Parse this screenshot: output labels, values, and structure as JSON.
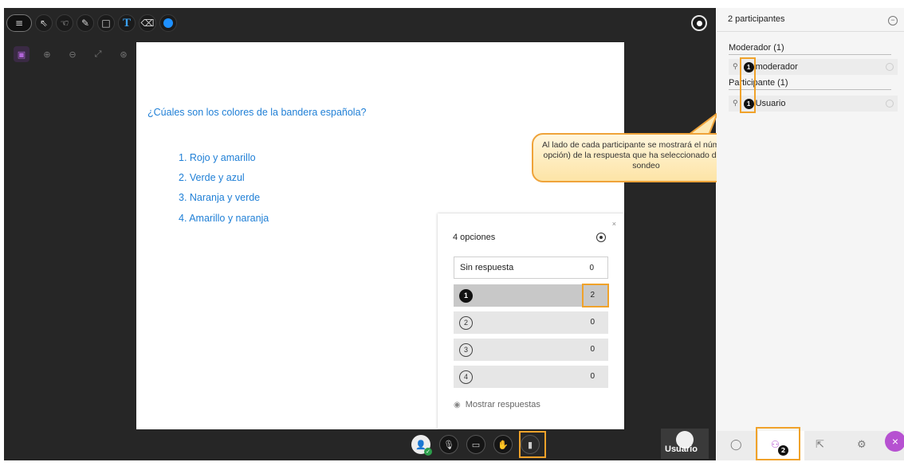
{
  "toolbar": {
    "menu_icon": "≡",
    "select_icon": "⇖",
    "pan_icon": "☜",
    "pen_icon": "✎",
    "shape_icon": "□",
    "text_icon": "T",
    "eraser_icon": "⌫",
    "color_value": "#1e90ff"
  },
  "subtoolbar": {
    "icons": [
      "▣",
      "⊕",
      "⊖",
      "⤢",
      "⊛"
    ]
  },
  "slide": {
    "question": "¿Cúales son los colores de la bandera española?",
    "options": [
      "1. Rojo y amarillo",
      "2. Verde y azul",
      "3. Naranja y verde",
      "4. Amarillo y naranja"
    ]
  },
  "poll": {
    "close": "×",
    "title": "4 opciones",
    "rows": [
      {
        "label": "Sin respuesta",
        "count": "0"
      },
      {
        "label": "1",
        "count": "2"
      },
      {
        "label": "2",
        "count": "0"
      },
      {
        "label": "3",
        "count": "0"
      },
      {
        "label": "4",
        "count": "0"
      }
    ],
    "show_answers": "Mostrar respuestas"
  },
  "callout": {
    "text": "Al lado de cada participante se mostrará el número (o la opción) de la respuesta que ha seleccionado durante el sondeo"
  },
  "controls": {
    "mic_icon": "🎙",
    "camera_icon": "▭",
    "hand_icon": "✋",
    "poll_icon": "▮"
  },
  "user_tile": {
    "name": "Usuario"
  },
  "panel": {
    "header": "2 participantes",
    "collapse_icon": "−",
    "moderators_heading": "Moderador (1)",
    "moderator": {
      "badge": "1",
      "name": "moderador"
    },
    "participants_heading": "Participante (1)",
    "participant": {
      "badge": "1",
      "name": "Usuario"
    },
    "bottom_badge": "2",
    "close_icon": "×"
  },
  "colors": {
    "accent_orange": "#f0a22a",
    "brand_purple": "#b651d1",
    "slide_text_blue": "#1f7fd6"
  }
}
